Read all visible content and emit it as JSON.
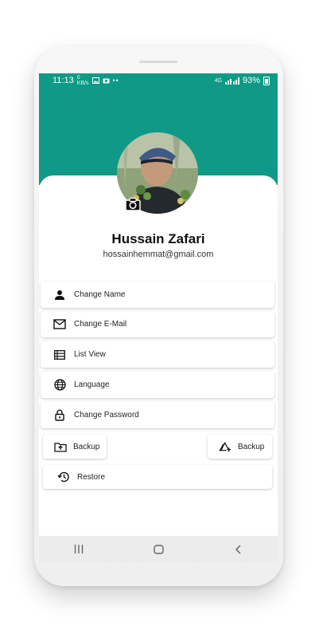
{
  "status_bar": {
    "time": "11:13",
    "data_rate": "0\nKB/s",
    "battery": "93%",
    "signal_label": "4G"
  },
  "profile": {
    "name": "Hussain Zafari",
    "email": "hossainhemmat@gmail.com"
  },
  "menu": {
    "items": [
      {
        "label": "Change Name",
        "icon": "person-icon"
      },
      {
        "label": "Change E-Mail",
        "icon": "mail-icon"
      },
      {
        "label": "List View",
        "icon": "list-view-icon"
      },
      {
        "label": "Language",
        "icon": "globe-icon"
      },
      {
        "label": "Change Password",
        "icon": "lock-icon"
      }
    ]
  },
  "actions": {
    "backup_local": "Backup",
    "backup_cloud": "Backup",
    "restore": "Restore"
  },
  "colors": {
    "header": "#0e9a86"
  }
}
